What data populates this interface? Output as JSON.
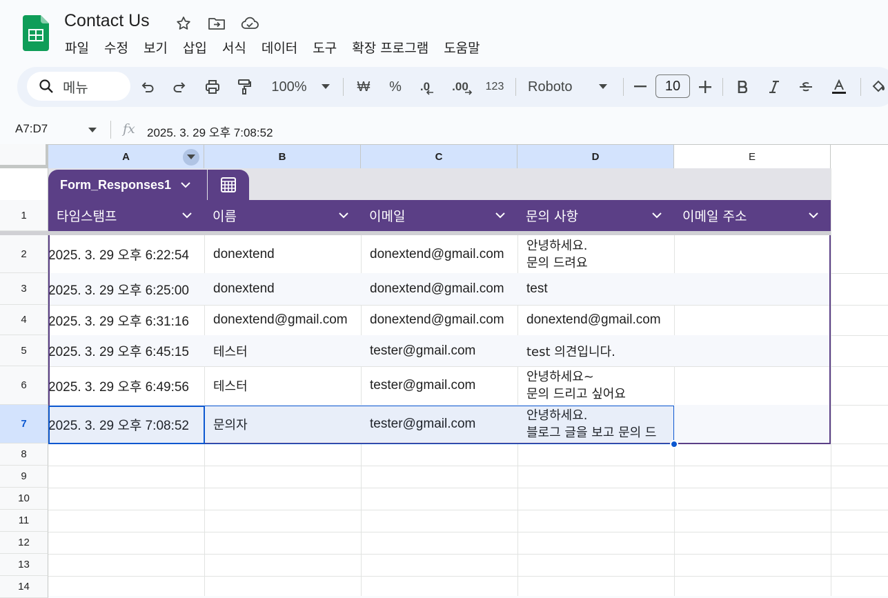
{
  "document": {
    "title": "Contact Us"
  },
  "menu": [
    "파일",
    "수정",
    "보기",
    "삽입",
    "서식",
    "데이터",
    "도구",
    "확장 프로그램",
    "도움말"
  ],
  "toolbar": {
    "search_label": "메뉴",
    "zoom": "100%",
    "currency": "₩",
    "percent": "%",
    "dec_decrease": ".0",
    "dec_increase": ".00",
    "number_format": "123",
    "font": "Roboto",
    "font_size": "10"
  },
  "formula_bar": {
    "name_box": "A7:D7",
    "formula": "2025. 3. 29 오후 7:08:52"
  },
  "columns": [
    "A",
    "B",
    "C",
    "D",
    "E"
  ],
  "row_numbers": [
    "1",
    "2",
    "3",
    "4",
    "5",
    "6",
    "7",
    "8",
    "9",
    "10",
    "11",
    "12",
    "13",
    "14"
  ],
  "table": {
    "name": "Form_Responses1",
    "headers": [
      "타임스탬프",
      "이름",
      "이메일",
      "문의 사항",
      "이메일 주소"
    ],
    "rows": [
      [
        "2025. 3. 29 오후 6:22:54",
        "donextend",
        "donextend@gmail.com",
        "안녕하세요.\n문의 드려요",
        ""
      ],
      [
        "2025. 3. 29 오후 6:25:00",
        "donextend",
        "donextend@gmail.com",
        "test",
        ""
      ],
      [
        "2025. 3. 29 오후 6:31:16",
        "donextend@gmail.com",
        "donextend@gmail.com",
        "donextend@gmail.com",
        ""
      ],
      [
        "2025. 3. 29 오후 6:45:15",
        "테스터",
        "tester@gmail.com",
        "test 의견입니다.",
        ""
      ],
      [
        "2025. 3. 29 오후 6:49:56",
        "테스터",
        "tester@gmail.com",
        "안녕하세요~\n문의 드리고 싶어요",
        ""
      ],
      [
        "2025. 3. 29 오후 7:08:52",
        "문의자",
        "tester@gmail.com",
        "안녕하세요.\n블로그 글을 보고 문의 드",
        ""
      ]
    ]
  },
  "colors": {
    "table_header": "#5b3f86",
    "selection": "#0b57d0",
    "selection_fill": "#d3e3fd",
    "sheets_green": "#0f9d58"
  }
}
